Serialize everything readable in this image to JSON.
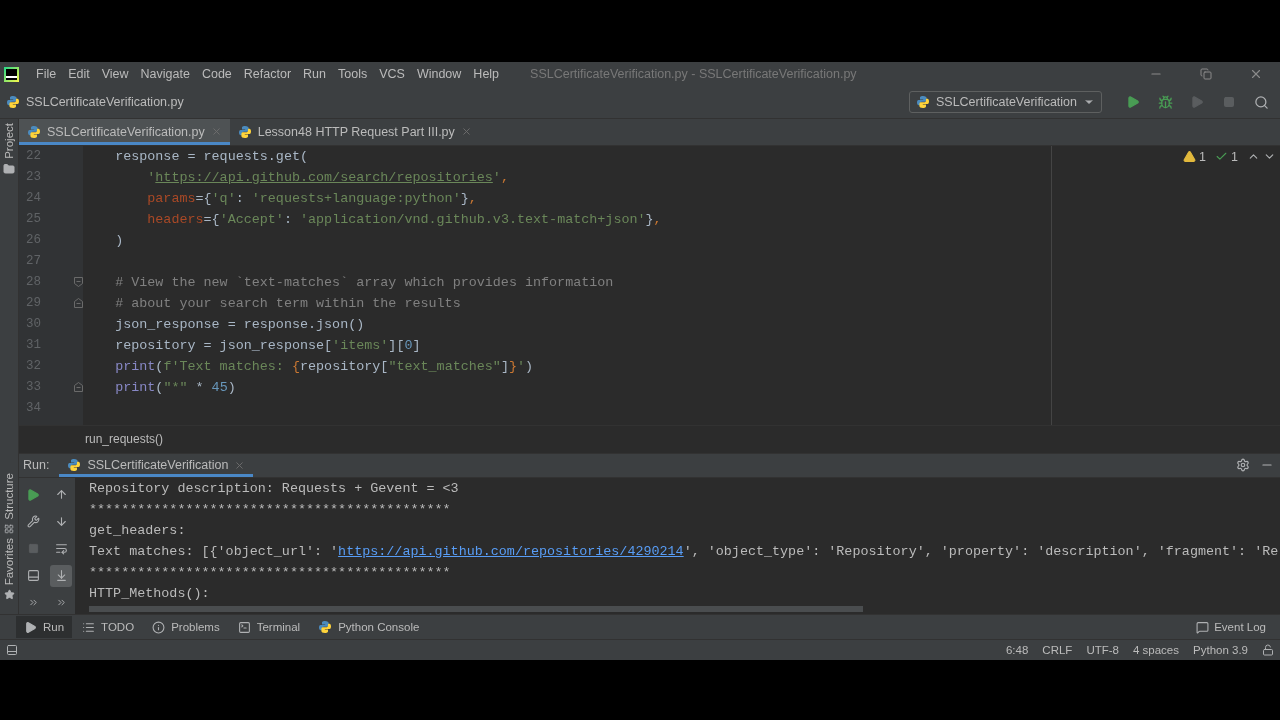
{
  "menu_bar": {
    "items": [
      "File",
      "Edit",
      "View",
      "Navigate",
      "Code",
      "Refactor",
      "Run",
      "Tools",
      "VCS",
      "Window",
      "Help"
    ],
    "title": "SSLCertificateVerification.py - SSLCertificateVerification.py"
  },
  "nav_bar": {
    "file": "SSLCertificateVerification.py",
    "run_config": "SSLCertificateVerification"
  },
  "left_stripe": {
    "top": "Project",
    "bottom": [
      "Structure",
      "Favorites"
    ]
  },
  "editor_tabs": [
    {
      "label": "SSLCertificateVerification.py",
      "selected": true
    },
    {
      "label": "Lesson48 HTTP Request Part III.py",
      "selected": false
    }
  ],
  "editor": {
    "warnings": "1",
    "typos": "1",
    "lines": [
      {
        "number": "22",
        "kind": "code",
        "tokens": [
          {
            "kind": "plain",
            "text": "    response = requests.get("
          }
        ]
      },
      {
        "number": "23",
        "kind": "code",
        "tokens": [
          {
            "kind": "string",
            "text": "        '"
          },
          {
            "kind": "link",
            "text": "https://api.github.com/search/repositories"
          },
          {
            "kind": "string",
            "text": "'"
          },
          {
            "kind": "punct",
            "text": ","
          }
        ]
      },
      {
        "number": "24",
        "kind": "code",
        "tokens": [
          {
            "kind": "kwarg",
            "text": "        params"
          },
          {
            "kind": "plain",
            "text": "={"
          },
          {
            "kind": "string",
            "text": "'q'"
          },
          {
            "kind": "plain",
            "text": ": "
          },
          {
            "kind": "string",
            "text": "'requests+language:python'"
          },
          {
            "kind": "plain",
            "text": "}"
          },
          {
            "kind": "punct",
            "text": ","
          }
        ]
      },
      {
        "number": "25",
        "kind": "code",
        "tokens": [
          {
            "kind": "kwarg",
            "text": "        headers"
          },
          {
            "kind": "plain",
            "text": "={"
          },
          {
            "kind": "string",
            "text": "'Accept'"
          },
          {
            "kind": "plain",
            "text": ": "
          },
          {
            "kind": "string",
            "text": "'application/vnd.github.v3.text-match+json'"
          },
          {
            "kind": "plain",
            "text": "}"
          },
          {
            "kind": "punct",
            "text": ","
          }
        ]
      },
      {
        "number": "26",
        "kind": "code",
        "tokens": [
          {
            "kind": "plain",
            "text": "    )"
          }
        ]
      },
      {
        "number": "27",
        "kind": "code"
      },
      {
        "number": "28",
        "kind": "fold-start",
        "tokens": [
          {
            "kind": "comment",
            "text": "    # View the new `text-matches` array which provides information"
          }
        ]
      },
      {
        "number": "29",
        "kind": "fold-end",
        "tokens": [
          {
            "kind": "comment",
            "text": "    # about your search term within the results"
          }
        ]
      },
      {
        "number": "30",
        "kind": "code",
        "tokens": [
          {
            "kind": "plain",
            "text": "    json_response = response.json()"
          }
        ]
      },
      {
        "number": "31",
        "kind": "code",
        "tokens": [
          {
            "kind": "plain",
            "text": "    repository = json_response["
          },
          {
            "kind": "string",
            "text": "'items'"
          },
          {
            "kind": "plain",
            "text": "]["
          },
          {
            "kind": "number",
            "text": "0"
          },
          {
            "kind": "plain",
            "text": "]"
          }
        ]
      },
      {
        "number": "32",
        "kind": "code",
        "tokens": [
          {
            "kind": "builtin",
            "text": "    print"
          },
          {
            "kind": "plain",
            "text": "("
          },
          {
            "kind": "string",
            "text": "f'Text matches: "
          },
          {
            "kind": "punct",
            "text": "{"
          },
          {
            "kind": "plain",
            "text": "repository["
          },
          {
            "kind": "string",
            "text": "\"text_matches\""
          },
          {
            "kind": "plain",
            "text": "]"
          },
          {
            "kind": "punct",
            "text": "}"
          },
          {
            "kind": "string",
            "text": "'"
          },
          {
            "kind": "plain",
            "text": ")"
          }
        ]
      },
      {
        "number": "33",
        "kind": "fold-end",
        "tokens": [
          {
            "kind": "builtin",
            "text": "    print"
          },
          {
            "kind": "plain",
            "text": "("
          },
          {
            "kind": "string",
            "text": "\"*\""
          },
          {
            "kind": "plain",
            "text": " * "
          },
          {
            "kind": "number",
            "text": "45"
          },
          {
            "kind": "plain",
            "text": ")"
          }
        ]
      },
      {
        "number": "34",
        "kind": "code"
      }
    ]
  },
  "breadcrumb": "run_requests()",
  "run_panel": {
    "label": "Run:",
    "tab": "SSLCertificateVerification",
    "lines": [
      {
        "tokens": [
          {
            "kind": "plain",
            "text": "Repository description: Requests + Gevent = <3"
          }
        ]
      },
      {
        "tokens": [
          {
            "kind": "plain",
            "text": "*********************************************"
          }
        ]
      },
      {
        "tokens": [
          {
            "kind": "plain",
            "text": "get_headers:"
          }
        ]
      },
      {
        "tokens": [
          {
            "kind": "plain",
            "text": "Text matches: [{'object_url': '"
          },
          {
            "kind": "link",
            "text": "https://api.github.com/repositories/4290214"
          },
          {
            "kind": "plain",
            "text": "', 'object_type': 'Repository', 'property': 'description', 'fragment': 'Re"
          }
        ]
      },
      {
        "tokens": [
          {
            "kind": "plain",
            "text": "*********************************************"
          }
        ]
      },
      {
        "tokens": [
          {
            "kind": "plain",
            "text": "HTTP_Methods():"
          }
        ]
      }
    ]
  },
  "tool_tabs": [
    {
      "label": "Run",
      "selected": true
    },
    {
      "label": "TODO",
      "selected": false
    },
    {
      "label": "Problems",
      "selected": false
    },
    {
      "label": "Terminal",
      "selected": false
    },
    {
      "label": "Python Console",
      "selected": false
    }
  ],
  "event_log": "Event Log",
  "status_bar": [
    "6:48",
    "CRLF",
    "UTF-8",
    "4 spaces",
    "Python 3.9"
  ]
}
